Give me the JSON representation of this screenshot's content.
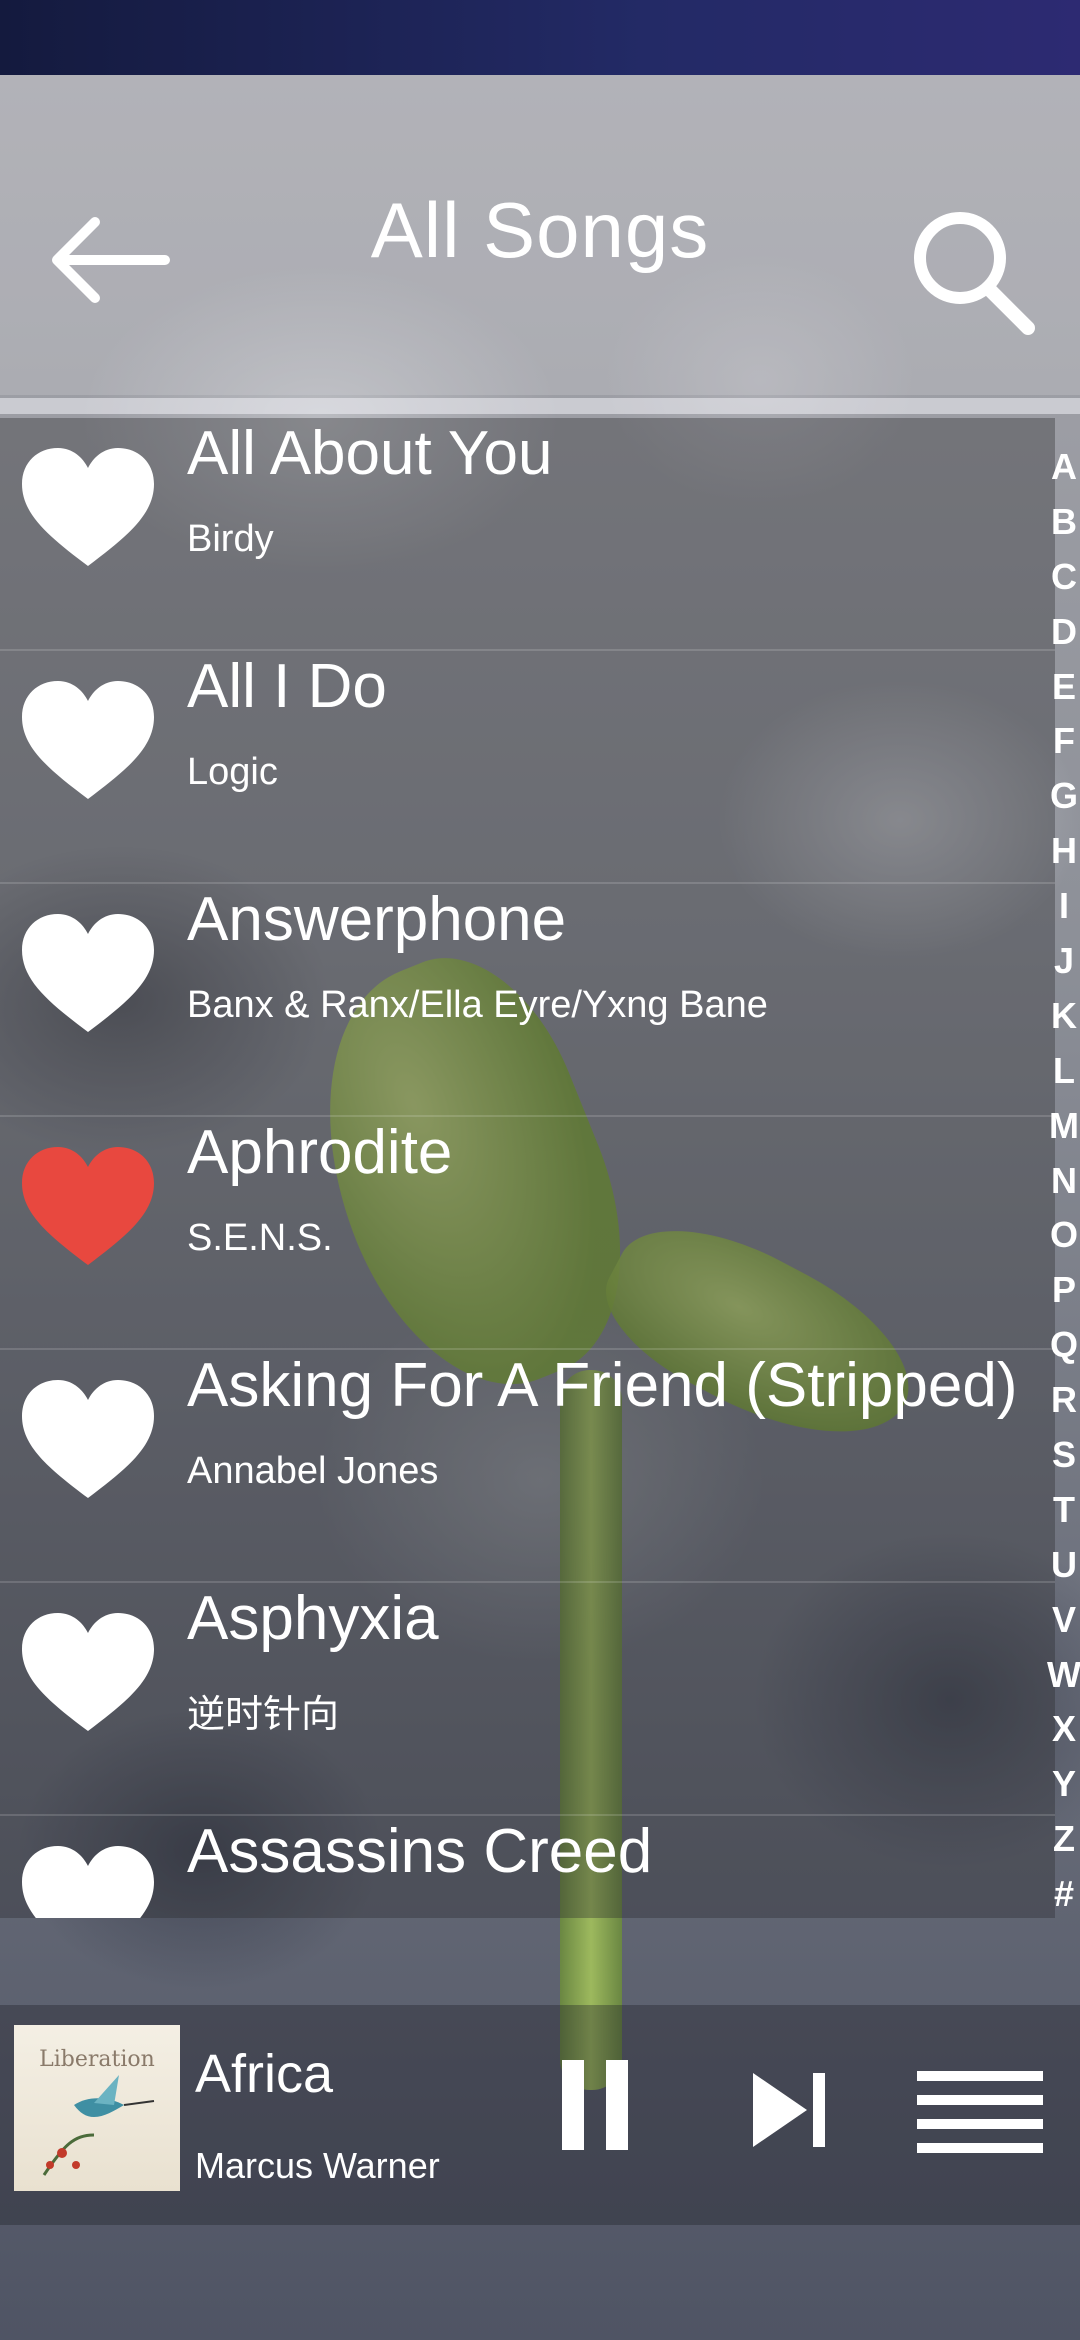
{
  "header": {
    "title": "All Songs",
    "back_icon": "arrow-left-icon",
    "search_icon": "search-icon"
  },
  "songs": [
    {
      "title": "All About You",
      "artist": "Birdy",
      "favorite": false
    },
    {
      "title": "All I Do",
      "artist": "Logic",
      "favorite": false
    },
    {
      "title": "Answerphone",
      "artist": "Banx & Ranx/Ella Eyre/Yxng Bane",
      "favorite": false
    },
    {
      "title": "Aphrodite",
      "artist": "S.E.N.S.",
      "favorite": true
    },
    {
      "title": "Asking For A Friend (Stripped)",
      "artist": "Annabel Jones",
      "favorite": false
    },
    {
      "title": "Asphyxia",
      "artist": "逆时针向",
      "favorite": false
    },
    {
      "title": "Assassins Creed",
      "artist": "",
      "favorite": false
    }
  ],
  "alphabet_index": [
    "A",
    "B",
    "C",
    "D",
    "E",
    "F",
    "G",
    "H",
    "I",
    "J",
    "K",
    "L",
    "M",
    "N",
    "O",
    "P",
    "Q",
    "R",
    "S",
    "T",
    "U",
    "V",
    "W",
    "X",
    "Y",
    "Z",
    "#"
  ],
  "now_playing": {
    "song": "Africa",
    "artist": "Marcus Warner",
    "album_art_text": "Liberation"
  },
  "colors": {
    "favorite": "#e8483f",
    "heart_default": "#ffffff",
    "status_bar": "#1c2250"
  }
}
